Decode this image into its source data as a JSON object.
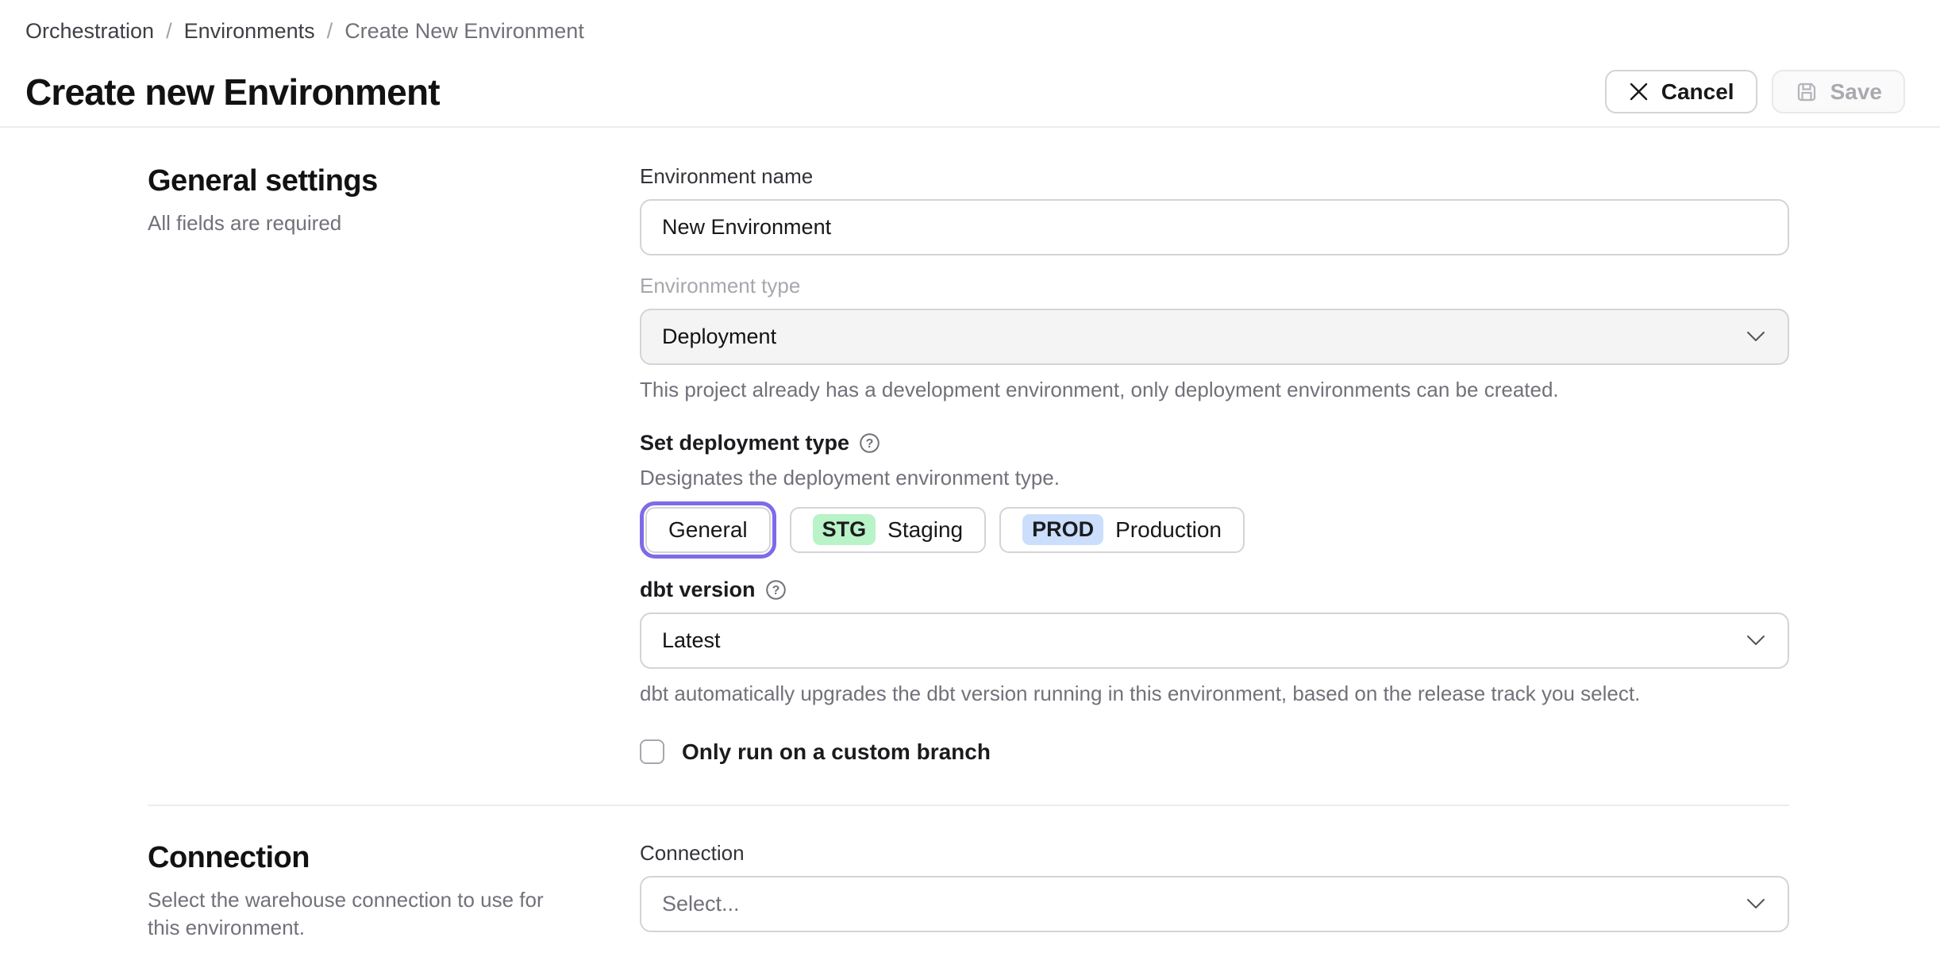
{
  "breadcrumb": {
    "separator": "/",
    "items": [
      {
        "label": "Orchestration"
      },
      {
        "label": "Environments"
      },
      {
        "label": "Create New Environment"
      }
    ]
  },
  "header": {
    "title": "Create new Environment",
    "cancel_label": "Cancel",
    "save_label": "Save",
    "save_disabled": true
  },
  "general": {
    "heading": "General settings",
    "subheading": "All fields are required",
    "environment_name": {
      "label": "Environment name",
      "value": "New Environment"
    },
    "environment_type": {
      "label": "Environment type",
      "value": "Deployment",
      "disabled": true,
      "help": "This project already has a development environment, only deployment environments can be created."
    },
    "deployment_type": {
      "label": "Set deployment type",
      "description": "Designates the deployment environment type.",
      "options": [
        {
          "label": "General",
          "badge": "",
          "selected": true
        },
        {
          "label": "Staging",
          "badge": "STG",
          "selected": false
        },
        {
          "label": "Production",
          "badge": "PROD",
          "selected": false
        }
      ]
    },
    "dbt_version": {
      "label": "dbt version",
      "value": "Latest",
      "help": "dbt automatically upgrades the dbt version running in this environment, based on the release track you select."
    },
    "custom_branch": {
      "label": "Only run on a custom branch",
      "checked": false
    }
  },
  "connection": {
    "heading": "Connection",
    "subheading": "Select the warehouse connection to use for this environment.",
    "field_label": "Connection",
    "placeholder": "Select..."
  },
  "colors": {
    "accent_purple": "#7d6be8",
    "badge_staging_bg": "#b9f3c8",
    "badge_production_bg": "#cbdefb",
    "border_gray": "#d4d4d8",
    "disabled_field_bg": "#f4f4f5",
    "muted_text": "#71717a"
  }
}
